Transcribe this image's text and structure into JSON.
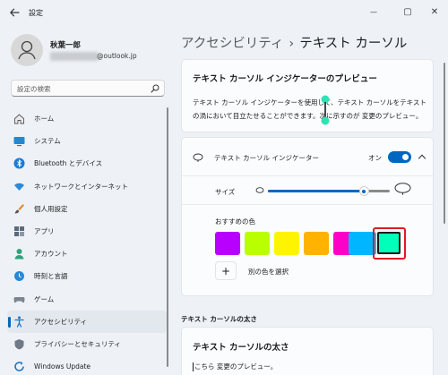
{
  "titlebar": {
    "app_title": "設定",
    "minimize": "—",
    "maximize": "▢",
    "close": "✕"
  },
  "profile": {
    "name": "秋葉一郎",
    "email_domain": "@outlook.jp"
  },
  "search": {
    "placeholder": "設定の検索"
  },
  "sidebar": {
    "items": [
      {
        "label": "ホーム",
        "icon": "home-icon"
      },
      {
        "label": "システム",
        "icon": "monitor-icon"
      },
      {
        "label": "Bluetooth とデバイス",
        "icon": "bluetooth-icon"
      },
      {
        "label": "ネットワークとインターネット",
        "icon": "wifi-icon"
      },
      {
        "label": "個人用設定",
        "icon": "paintbrush-icon"
      },
      {
        "label": "アプリ",
        "icon": "apps-icon"
      },
      {
        "label": "アカウント",
        "icon": "account-icon"
      },
      {
        "label": "時刻と言語",
        "icon": "globe-clock-icon"
      },
      {
        "label": "ゲーム",
        "icon": "gamepad-icon"
      },
      {
        "label": "アクセシビリティ",
        "icon": "accessibility-icon",
        "active": true
      },
      {
        "label": "プライバシーとセキュリティ",
        "icon": "shield-icon"
      },
      {
        "label": "Windows Update",
        "icon": "update-icon"
      }
    ]
  },
  "breadcrumb": {
    "parent": "アクセシビリティ",
    "separator": "›",
    "current": "テキスト カーソル"
  },
  "preview": {
    "title": "テキスト カーソル インジケーターのプレビュー",
    "description": "テキスト カーソル インジケーターを使用して、テキスト カーソルをテキストの渦において目立たせることができます。次に示すのが 変更のプレビュー。"
  },
  "indicator": {
    "label": "テキスト カーソル インジケーター",
    "toggle_label": "オン",
    "toggle_on": true,
    "size_label": "サイズ",
    "size_value": 0.79,
    "colors_label": "おすすめの色",
    "colors": [
      "#b700ff",
      "#b9ff00",
      "#fff400",
      "#ffb300",
      "#ff00c8",
      "#00b7ff",
      "#00ffb8"
    ],
    "selected_color_index": 6,
    "cursor_color": "#2fe2b5",
    "add_color_label": "別の色を選択",
    "add_color_symbol": "+"
  },
  "thickness": {
    "section_header": "テキスト カーソルの太さ",
    "card_title": "テキスト カーソルの太さ",
    "preview_text": "こちら 変更のプレビュー。"
  },
  "accent_color": "#0067c0"
}
